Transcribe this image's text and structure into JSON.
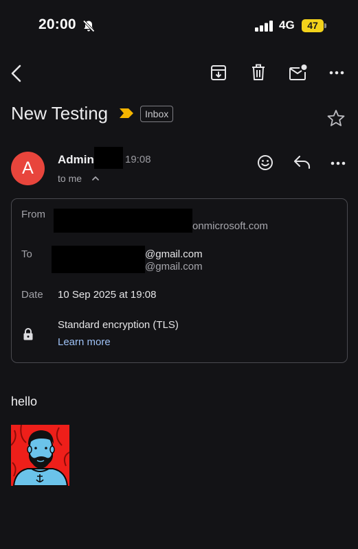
{
  "status_bar": {
    "time": "20:00",
    "network": "4G",
    "battery": "47",
    "icons": [
      "bell-muted-icon",
      "signal-icon",
      "battery-icon"
    ]
  },
  "toolbar": {
    "icons": [
      "back-arrow-icon",
      "archive-icon",
      "trash-icon",
      "mark-unread-icon",
      "more-horizontal-icon"
    ]
  },
  "email": {
    "subject": "New Testing",
    "label": "Inbox",
    "importance_color": "#f4b400",
    "sender": {
      "avatar_letter": "A",
      "avatar_color": "#e8453c",
      "name": "Admin",
      "time": "19:08",
      "to_me": "to me"
    },
    "details": {
      "from_label": "From",
      "from_value": "onmicrosoft.com",
      "to_label": "To",
      "to_value_1": "@gmail.com",
      "to_value_2": "@gmail.com",
      "date_label": "Date",
      "date_value": "10 Sep 2025 at 19:08",
      "encryption": "Standard encryption (TLS)",
      "learn_more": "Learn more"
    },
    "body": "hello"
  },
  "colors": {
    "background": "#131316",
    "link": "#9ec1f5",
    "battery": "#f2d21b"
  }
}
